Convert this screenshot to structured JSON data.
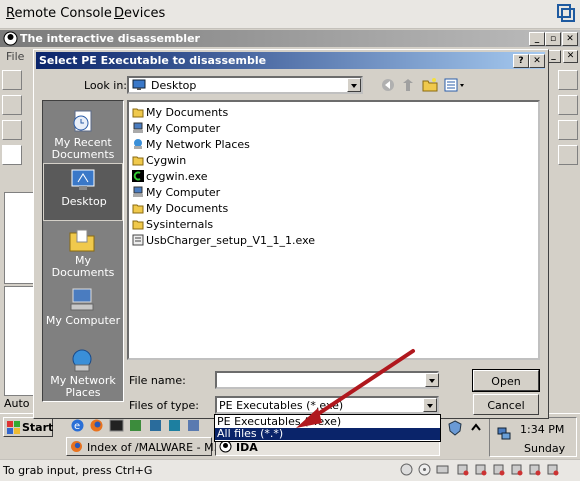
{
  "console": {
    "menus": [
      "Remote Console",
      "Devices"
    ],
    "logo_icon": "vmware-logo-icon",
    "status_text": "To grab input, press Ctrl+G",
    "status_icons": [
      "disk-icon",
      "cd-icon",
      "network-icon",
      "usb-icon",
      "device-icon",
      "device-icon",
      "device-icon",
      "device-icon",
      "device-icon"
    ]
  },
  "ida": {
    "title": "The interactive disassembler",
    "menu_first": "File",
    "status_mode": "Auto"
  },
  "dialog": {
    "title": "Select PE Executable to disassemble",
    "help_button": "?",
    "close_button": "✕",
    "look_in_label": "Look in:",
    "look_in_value": "Desktop",
    "places": [
      {
        "label": "My Recent Documents",
        "icon": "recent-documents-icon"
      },
      {
        "label": "Desktop",
        "icon": "desktop-icon"
      },
      {
        "label": "My Documents",
        "icon": "my-documents-icon"
      },
      {
        "label": "My Computer",
        "icon": "my-computer-icon"
      },
      {
        "label": "My Network Places",
        "icon": "network-places-icon"
      }
    ],
    "files": [
      {
        "name": "My Documents",
        "icon": "my-documents-icon"
      },
      {
        "name": "My Computer",
        "icon": "my-computer-icon"
      },
      {
        "name": "My Network Places",
        "icon": "network-places-icon"
      },
      {
        "name": "Cygwin",
        "icon": "folder-icon"
      },
      {
        "name": "cygwin.exe",
        "icon": "cygwin-icon"
      },
      {
        "name": "My Computer",
        "icon": "my-computer-icon"
      },
      {
        "name": "My Documents",
        "icon": "my-documents-icon"
      },
      {
        "name": "Sysinternals",
        "icon": "folder-icon"
      },
      {
        "name": "UsbCharger_setup_V1_1_1.exe",
        "icon": "installer-icon"
      }
    ],
    "file_name_label": "File name:",
    "file_name_value": "",
    "file_type_label": "Files of type:",
    "file_type_value": "PE Executables (*.exe)",
    "open_button": "Open",
    "cancel_button": "Cancel",
    "file_type_options": [
      "PE Executables (*.exe)",
      "All files (*.*)"
    ],
    "selected_option": "All files (*.*)"
  },
  "taskbar": {
    "start_label": "Start",
    "tasks": [
      {
        "label": "Index of /MALWARE - M...",
        "icon": "firefox-icon",
        "active": false
      },
      {
        "label": "IDA",
        "icon": "ida-icon",
        "active": true
      }
    ],
    "clock": "1:34 PM",
    "day": "Sunday"
  },
  "colors": {
    "dialog_titlebar": "#0a246a",
    "annotation_arrow": "#b0181e",
    "selection": "#0a246a"
  }
}
